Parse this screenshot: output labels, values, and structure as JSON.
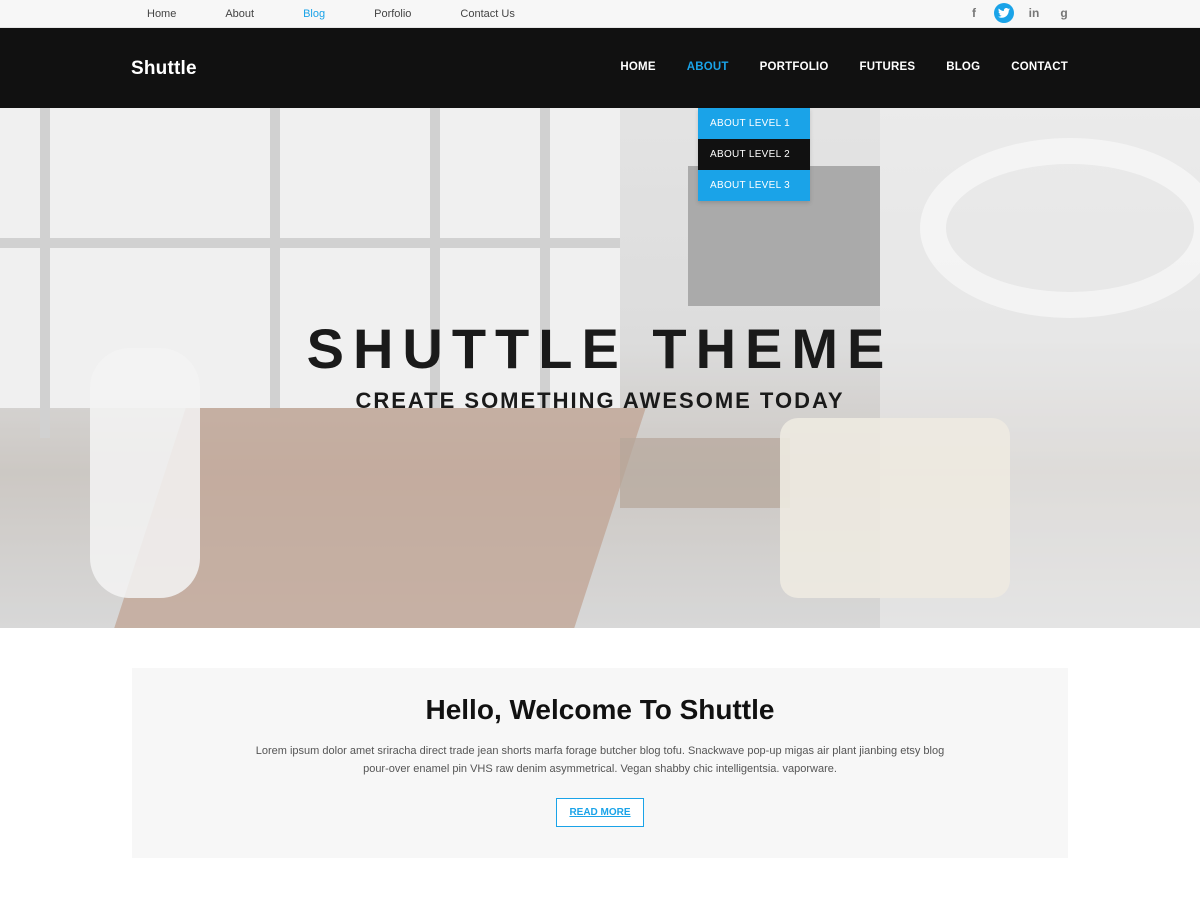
{
  "topbar": {
    "links": [
      "Home",
      "About",
      "Blog",
      "Porfolio",
      "Contact Us"
    ],
    "active_link": "Blog",
    "social": [
      {
        "icon": "facebook-icon",
        "glyph": "f"
      },
      {
        "icon": "twitter-icon",
        "glyph": "t"
      },
      {
        "icon": "linkedin-icon",
        "glyph": "in"
      },
      {
        "icon": "google-plus-icon",
        "glyph": "g"
      }
    ]
  },
  "header": {
    "logo": "Shuttle",
    "nav": [
      "HOME",
      "ABOUT",
      "PORTFOLIO",
      "FUTURES",
      "BLOG",
      "CONTACT"
    ],
    "active_nav": "ABOUT"
  },
  "dropdown": {
    "items": [
      "ABOUT LEVEL 1",
      "ABOUT LEVEL 2",
      "ABOUT LEVEL 3"
    ],
    "highlighted": "ABOUT LEVEL 2"
  },
  "hero": {
    "title": "SHUTTLE THEME",
    "subtitle": "CREATE SOMETHING AWESOME TODAY"
  },
  "welcome": {
    "heading": "Hello, Welcome To Shuttle",
    "body": "Lorem ipsum dolor amet sriracha direct trade jean shorts marfa forage butcher blog tofu. Snackwave pop-up migas air plant  jianbing etsy blog pour-over enamel pin VHS raw denim asymmetrical. Vegan shabby chic intelligentsia. vaporware.",
    "button": "READ MORE"
  },
  "colors": {
    "accent": "#1aa3e8",
    "header_bg": "#111111",
    "topbar_bg": "#f7f7f7"
  }
}
